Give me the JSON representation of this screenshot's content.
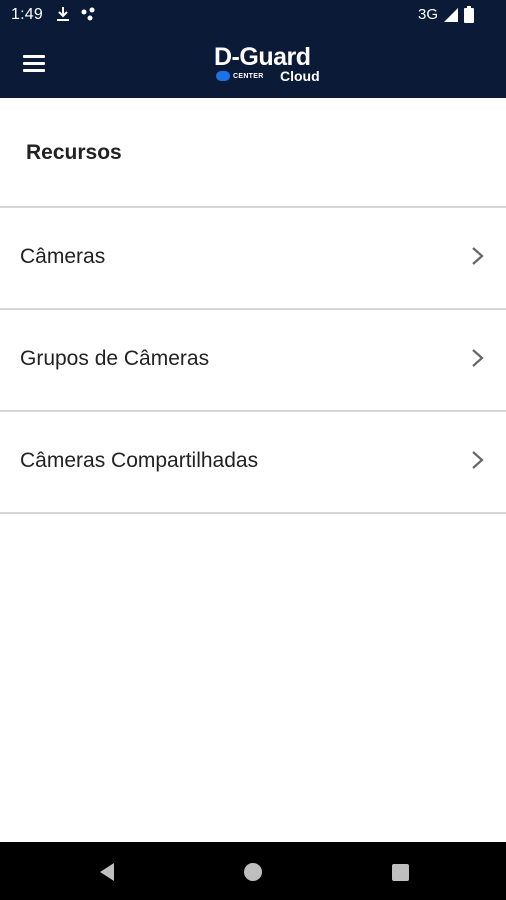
{
  "status_bar": {
    "time": "1:49",
    "icons": [
      "download-icon",
      "notification-dots-icon"
    ],
    "network": "3G",
    "signal_icon": "cellular-signal-icon",
    "battery_icon": "battery-icon"
  },
  "app_bar": {
    "menu_icon": "hamburger-menu-icon",
    "logo": {
      "main": "D-Guard",
      "center": "CENTER",
      "cloud": "Cloud"
    }
  },
  "colors": {
    "header_bg": "#0b1a36",
    "logo_accent": "#1a73e8",
    "divider": "#d6d6d6",
    "text": "#222222",
    "chevron": "#666666"
  },
  "section": {
    "title": "Recursos"
  },
  "items": [
    {
      "label": "Câmeras",
      "icon": "chevron-right-icon"
    },
    {
      "label": "Grupos de Câmeras",
      "icon": "chevron-right-icon"
    },
    {
      "label": "Câmeras Compartilhadas",
      "icon": "chevron-right-icon"
    }
  ],
  "nav_bar": {
    "buttons": [
      "back-icon",
      "home-icon",
      "recents-icon"
    ]
  }
}
